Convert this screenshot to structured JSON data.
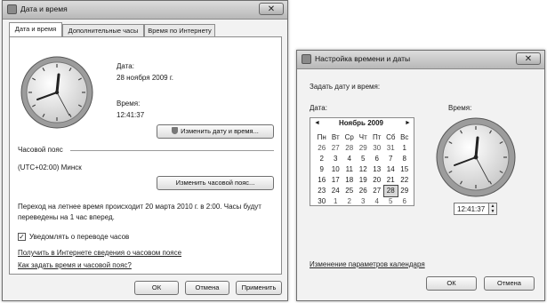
{
  "left_window": {
    "title": "Дата и время",
    "close_glyph": "✕",
    "tabs": [
      {
        "label": "Дата и время"
      },
      {
        "label": "Дополнительные часы"
      },
      {
        "label": "Время по Интернету"
      }
    ],
    "date_label": "Дата:",
    "date_value": "28 ноября 2009 г.",
    "time_label": "Время:",
    "time_value": "12:41:37",
    "change_datetime_button": "Изменить дату и время...",
    "timezone_heading": "Часовой пояс",
    "timezone_value": "(UTC+02:00) Минск",
    "change_timezone_button": "Изменить часовой пояс...",
    "dst_note_line1": "Переход на летнее время происходит 20 марта 2010 г. в 2:00. Часы будут",
    "dst_note_line2": "переведены на 1 час вперед.",
    "notify_checkbox_label": "Уведомлять о переводе часов",
    "notify_checked": true,
    "link_tz_info": "Получить в Интернете сведения о часовом поясе",
    "link_howto": "Как задать время и часовой пояс?",
    "ok_button": "ОК",
    "cancel_button": "Отмена",
    "apply_button": "Применить"
  },
  "right_window": {
    "title": "Настройка времени и даты",
    "close_glyph": "✕",
    "instruction": "Задать дату и время:",
    "date_label": "Дата:",
    "time_label": "Время:",
    "calendar": {
      "month_year": "Ноябрь 2009",
      "prev_glyph": "◄",
      "next_glyph": "►",
      "weekdays": [
        "Пн",
        "Вт",
        "Ср",
        "Чт",
        "Пт",
        "Сб",
        "Вс"
      ],
      "weeks": [
        [
          "26",
          "27",
          "28",
          "29",
          "30",
          "31",
          "1"
        ],
        [
          "2",
          "3",
          "4",
          "5",
          "6",
          "7",
          "8"
        ],
        [
          "9",
          "10",
          "11",
          "12",
          "13",
          "14",
          "15"
        ],
        [
          "16",
          "17",
          "18",
          "19",
          "20",
          "21",
          "22"
        ],
        [
          "23",
          "24",
          "25",
          "26",
          "27",
          "28",
          "29"
        ],
        [
          "30",
          "1",
          "2",
          "3",
          "4",
          "5",
          "6"
        ]
      ],
      "selected_day": "28"
    },
    "time_value": "12:41:37",
    "link_calendar_settings": "Изменение параметров календаря",
    "ok_button": "ОК",
    "cancel_button": "Отмена"
  }
}
